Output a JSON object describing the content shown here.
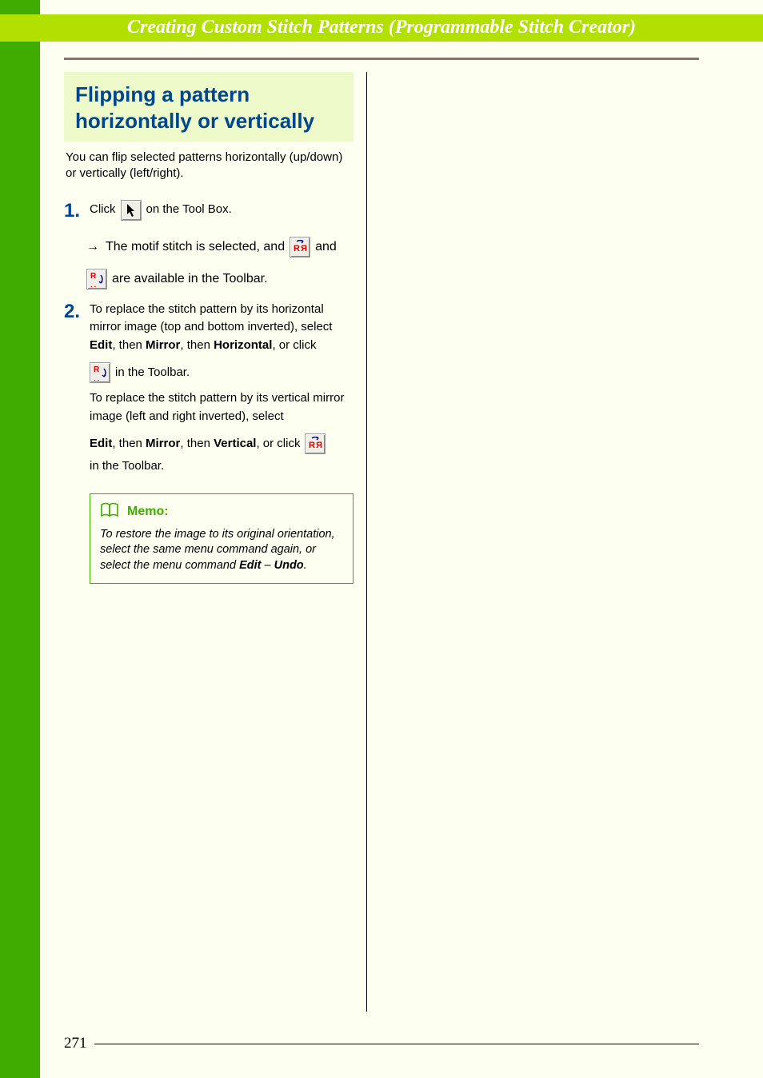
{
  "header": {
    "title": "Creating Custom Stitch Patterns (Programmable Stitch Creator)"
  },
  "section": {
    "heading": "Flipping a pattern horizontally or vertically",
    "intro": "You can flip selected patterns horizontally (up/down) or vertically (left/right)."
  },
  "steps": {
    "s1": {
      "num": "1.",
      "click": "Click",
      "on_toolbox": "on the Tool Box.",
      "result_pre": "The motif stitch is selected, and",
      "result_mid": "and",
      "result_post": "are available in the Toolbar."
    },
    "s2": {
      "num": "2.",
      "p1_a": "To replace the stitch pattern by its horizontal mirror image (top and bottom inverted), select ",
      "p1_edit": "Edit",
      "p1_then1": ", then ",
      "p1_mirror": "Mirror",
      "p1_then2": ", then ",
      "p1_horiz": "Horizontal",
      "p1_orclick": ", or click",
      "p1_tail": "in the Toolbar.",
      "p2": "To replace the stitch pattern by its vertical mirror image (left and right inverted), select",
      "p3_edit": "Edit",
      "p3_then1": ", then ",
      "p3_mirror": "Mirror",
      "p3_then2": ", then ",
      "p3_vert": "Vertical",
      "p3_orclick": ", or click",
      "p3_tail": "in the Toolbar."
    }
  },
  "memo": {
    "label": "Memo:",
    "body_a": "To restore the image to its original orientation, select the same menu command again, or select the menu command ",
    "body_edit": "Edit",
    "body_dash": " – ",
    "body_undo": "Undo",
    "body_end": "."
  },
  "icons": {
    "pointer": "pointer-tool-icon",
    "mirror_v": "mirror-vertical-icon",
    "mirror_h": "mirror-horizontal-icon",
    "book": "memo-book-icon"
  },
  "page_number": "271"
}
